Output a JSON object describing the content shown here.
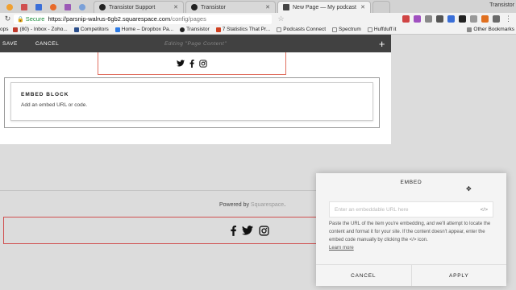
{
  "browser": {
    "tabs": [
      {
        "title": "Transistor Support"
      },
      {
        "title": "Transistor"
      },
      {
        "title": "New Page — My podcast"
      }
    ],
    "user_label": "Transistor",
    "left_partial": "ops",
    "address": {
      "secure_label": "Secure",
      "url_host": "https://parsnip-walrus-6gb2.squarespace.com",
      "url_path": "/config/pages"
    },
    "bookmarks": [
      {
        "label": "(80) - Inbox - Zoho...",
        "color": "#c0392b"
      },
      {
        "label": "Competitors",
        "color": "#2c4f8c"
      },
      {
        "label": "Home – Dropbox Pa...",
        "color": "#2d7be5"
      },
      {
        "label": "Transistor",
        "color": "#222222"
      },
      {
        "label": "7 Statistics That Pr...",
        "color": "#d04020"
      },
      {
        "label": "Podcasts Connect",
        "color": "#888888"
      },
      {
        "label": "Spectrum",
        "color": "#888888"
      },
      {
        "label": "Huffduff it",
        "color": "#888888"
      }
    ],
    "other_bookmarks": "Other Bookmarks"
  },
  "editor": {
    "save_label": "SAVE",
    "cancel_label": "CANCEL",
    "status": "Editing \"Page Content\"",
    "add_label": "+"
  },
  "embed_block": {
    "title": "EMBED BLOCK",
    "subtitle": "Add an embed URL or code."
  },
  "footer": {
    "powered_prefix": "Powered by ",
    "powered_link": "Squarespace",
    "powered_suffix": "."
  },
  "dialog": {
    "title": "EMBED",
    "input_placeholder": "Enter an embeddable URL here",
    "code_button": "</>",
    "help_text": "Paste the URL of the item you're embedding, and we'll attempt to locate the content and format it for your site. If the content doesn't appear, enter the embed code manually by clicking the </> icon.",
    "learn_more": "Learn more",
    "cancel_label": "CANCEL",
    "apply_label": "APPLY"
  }
}
